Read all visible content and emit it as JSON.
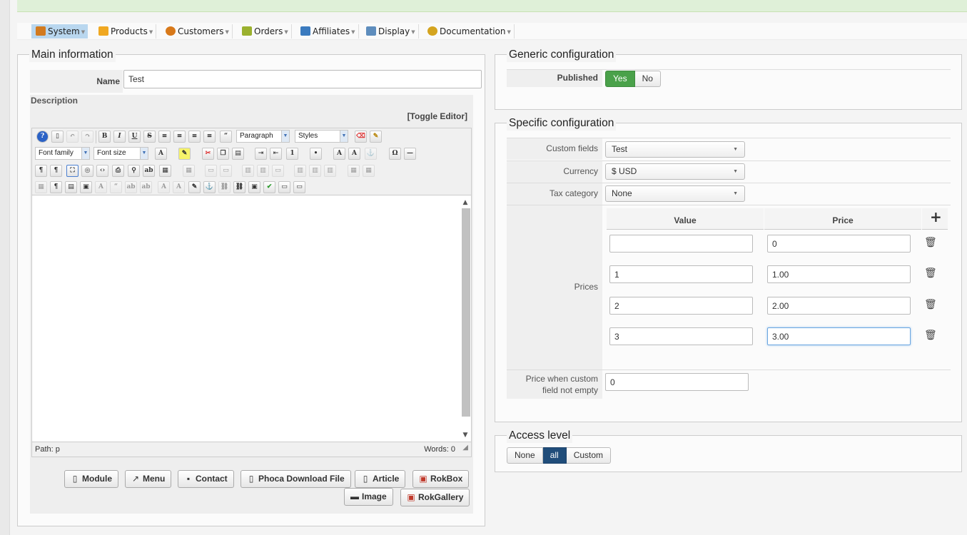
{
  "menu": [
    {
      "label": "System",
      "icon": "tools-icon",
      "color": "#d27a1f",
      "active": true
    },
    {
      "label": "Products",
      "icon": "box-icon",
      "color": "#f0a821"
    },
    {
      "label": "Customers",
      "icon": "users-icon",
      "color": "#d8791a"
    },
    {
      "label": "Orders",
      "icon": "orders-icon",
      "color": "#9bb12f"
    },
    {
      "label": "Affiliates",
      "icon": "affiliates-icon",
      "color": "#3b7bbf"
    },
    {
      "label": "Display",
      "icon": "display-icon",
      "color": "#5e8dbd"
    },
    {
      "label": "Documentation",
      "icon": "documentation-icon",
      "color": "#d4a41f"
    }
  ],
  "main_info": {
    "legend": "Main information",
    "name_label": "Name",
    "name_value": "Test",
    "description_label": "Description",
    "toggle_editor": "[Toggle Editor]",
    "format_select": "Paragraph",
    "styles_select": "Styles",
    "font_family_select": "Font family",
    "font_size_select": "Font size",
    "path": "Path: p",
    "words": "Words: 0",
    "buttons": [
      "Module",
      "Menu",
      "Contact",
      "Phoca Download File",
      "Article",
      "RokBox",
      "Image",
      "RokGallery"
    ]
  },
  "generic_config": {
    "legend": "Generic configuration",
    "published_label": "Published",
    "yes": "Yes",
    "no": "No"
  },
  "specific_config": {
    "legend": "Specific configuration",
    "custom_fields_label": "Custom fields",
    "custom_fields_value": "Test",
    "currency_label": "Currency",
    "currency_value": "$ USD",
    "tax_label": "Tax category",
    "tax_value": "None",
    "prices_label": "Prices",
    "value_header": "Value",
    "price_header": "Price",
    "price_rows": [
      {
        "value": "",
        "price": "0"
      },
      {
        "value": "1",
        "price": "1.00"
      },
      {
        "value": "2",
        "price": "2.00"
      },
      {
        "value": "3",
        "price": "3.00"
      }
    ],
    "custom_price_label_1": "Price when custom",
    "custom_price_label_2": "field not empty",
    "custom_price_value": "0"
  },
  "access": {
    "legend": "Access level",
    "options": [
      "None",
      "all",
      "Custom"
    ],
    "selected": "all"
  },
  "colors": {
    "accent_green": "#4aa14a",
    "accent_blue": "#204d7a",
    "top_strip": "#dff0d8"
  }
}
